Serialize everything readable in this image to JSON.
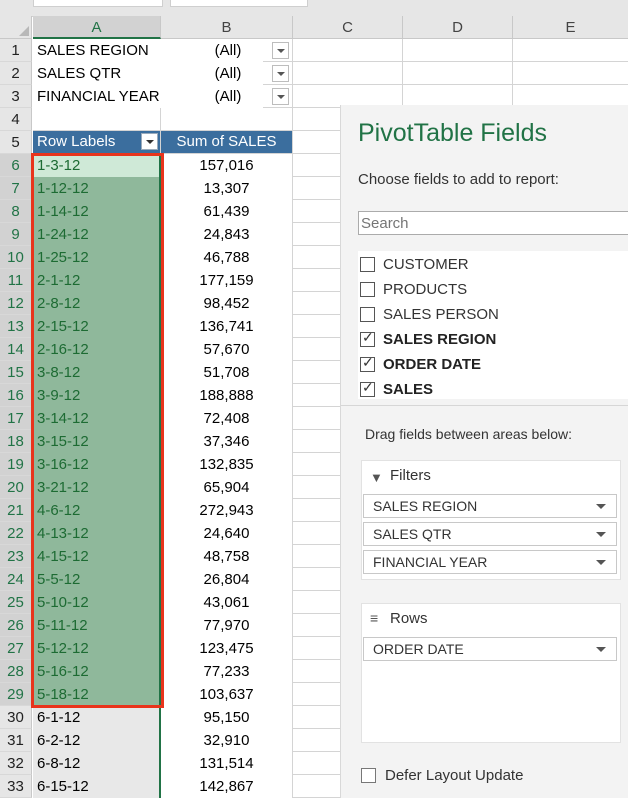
{
  "columns": [
    "A",
    "B",
    "C",
    "D",
    "E"
  ],
  "filters": [
    {
      "label": "SALES REGION",
      "value": "(All)"
    },
    {
      "label": "SALES QTR",
      "value": "(All)"
    },
    {
      "label": "FINANCIAL YEAR",
      "value": "(All)"
    }
  ],
  "pivot_header": {
    "row_labels": "Row Labels",
    "sum_label": "Sum of SALES"
  },
  "pivot_rows": [
    {
      "label": "1-3-12",
      "value": "157,016"
    },
    {
      "label": "1-12-12",
      "value": "13,307"
    },
    {
      "label": "1-14-12",
      "value": "61,439"
    },
    {
      "label": "1-24-12",
      "value": "24,843"
    },
    {
      "label": "1-25-12",
      "value": "46,788"
    },
    {
      "label": "2-1-12",
      "value": "177,159"
    },
    {
      "label": "2-8-12",
      "value": "98,452"
    },
    {
      "label": "2-15-12",
      "value": "136,741"
    },
    {
      "label": "2-16-12",
      "value": "57,670"
    },
    {
      "label": "3-8-12",
      "value": "51,708"
    },
    {
      "label": "3-9-12",
      "value": "188,888"
    },
    {
      "label": "3-14-12",
      "value": "72,408"
    },
    {
      "label": "3-15-12",
      "value": "37,346"
    },
    {
      "label": "3-16-12",
      "value": "132,835"
    },
    {
      "label": "3-21-12",
      "value": "65,904"
    },
    {
      "label": "4-6-12",
      "value": "272,943"
    },
    {
      "label": "4-13-12",
      "value": "24,640"
    },
    {
      "label": "4-15-12",
      "value": "48,758"
    },
    {
      "label": "5-5-12",
      "value": "26,804"
    },
    {
      "label": "5-10-12",
      "value": "43,061"
    },
    {
      "label": "5-11-12",
      "value": "77,970"
    },
    {
      "label": "5-12-12",
      "value": "123,475"
    },
    {
      "label": "5-16-12",
      "value": "77,233"
    },
    {
      "label": "5-18-12",
      "value": "103,637"
    },
    {
      "label": "6-1-12",
      "value": "95,150"
    },
    {
      "label": "6-2-12",
      "value": "32,910"
    },
    {
      "label": "6-8-12",
      "value": "131,514"
    },
    {
      "label": "6-15-12",
      "value": "142,867"
    }
  ],
  "selected_rows": 24,
  "pane": {
    "title": "PivotTable Fields",
    "subtitle": "Choose fields to add to report:",
    "search_placeholder": "Search",
    "fields": [
      {
        "label": "CUSTOMER",
        "checked": false
      },
      {
        "label": "PRODUCTS",
        "checked": false
      },
      {
        "label": "SALES PERSON",
        "checked": false
      },
      {
        "label": "SALES REGION",
        "checked": true
      },
      {
        "label": "ORDER DATE",
        "checked": true
      },
      {
        "label": "SALES",
        "checked": true
      }
    ],
    "drag_text": "Drag fields between areas below:",
    "filters_title": "Filters",
    "filters_items": [
      "SALES REGION",
      "SALES QTR",
      "FINANCIAL YEAR"
    ],
    "rows_title": "Rows",
    "rows_items": [
      "ORDER DATE"
    ],
    "defer_label": "Defer Layout Update"
  },
  "colors": {
    "header_blue": "#3b6e9e",
    "selection_green": "#8fb89b",
    "active_cell": "#cfe9d7",
    "text_green": "#1d6b33",
    "title_green": "#217346",
    "highlight_red": "#e8341c"
  }
}
